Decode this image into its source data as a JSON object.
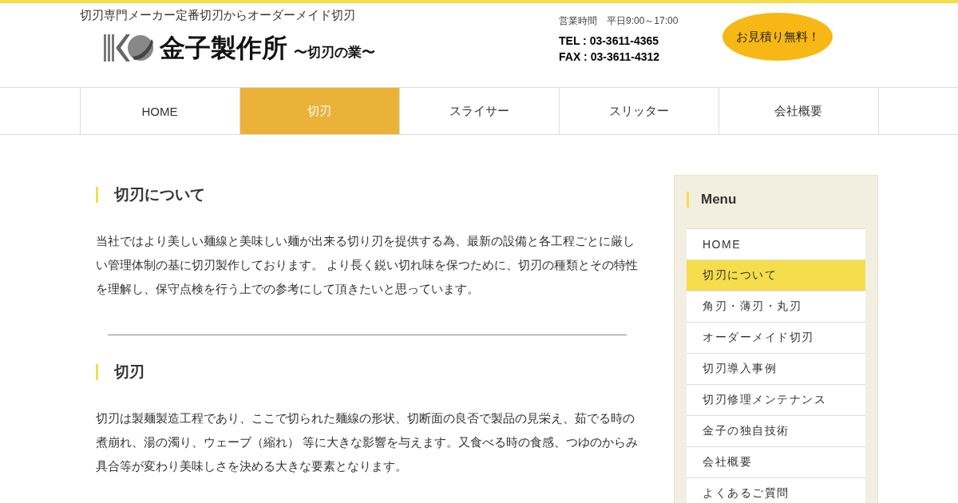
{
  "header": {
    "tagline": "切刃専門メーカー定番切刃からオーダーメイド切刃",
    "company_name": "金子製作所",
    "slogan": "〜切刃の業〜",
    "hours": "営業時間　平日9:00～17:00",
    "tel": "TEL : 03-3611-4365",
    "fax": "FAX : 03-3611-4312",
    "quote_button": "お見積り無料！"
  },
  "nav": [
    {
      "label": "HOME",
      "selected": false
    },
    {
      "label": "切刃",
      "selected": true
    },
    {
      "label": "スライサー",
      "selected": false
    },
    {
      "label": "スリッター",
      "selected": false
    },
    {
      "label": "会社概要",
      "selected": false
    }
  ],
  "sections": [
    {
      "heading": "切刃について",
      "body": "当社ではより美しい麺線と美味しい麺が出来る切り刃を提供する為、最新の設備と各工程ごとに厳しい管理体制の基に切刃製作しております。 より長く鋭い切れ味を保つために、切刃の種類とその特性を理解し、保守点検を行う上での参考にして頂きたいと思っています。"
    },
    {
      "heading": "切刃",
      "body": "切刃は製麺製造工程であり、ここで切られた麺線の形状、切断面の良否で製品の見栄え、茹でる時の煮崩れ、湯の濁り、ウェーブ（縮れ） 等に大きな影響を与えます。又食べる時の食感、つゆのからみ具合等が変わり美味しさを決める大きな要素となります。"
    }
  ],
  "sidebar": {
    "title": "Menu",
    "items": [
      {
        "label": "HOME",
        "selected": false
      },
      {
        "label": "切刃について",
        "selected": true
      },
      {
        "label": "角刃・薄刃・丸刃",
        "selected": false
      },
      {
        "label": "オーダーメイド切刃",
        "selected": false
      },
      {
        "label": "切刃導入事例",
        "selected": false
      },
      {
        "label": "切刃修理メンテナンス",
        "selected": false
      },
      {
        "label": "金子の独自技術",
        "selected": false
      },
      {
        "label": "会社概要",
        "selected": false
      },
      {
        "label": "よくあるご質問",
        "selected": false
      }
    ]
  }
}
